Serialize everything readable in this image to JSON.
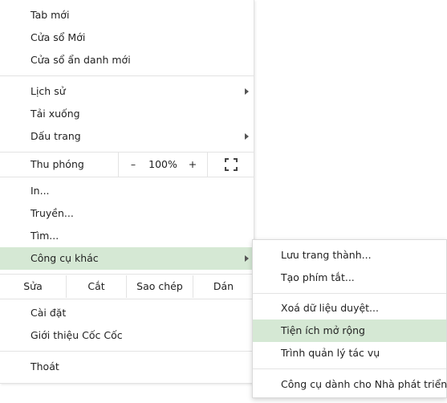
{
  "menu": {
    "new_tab": "Tab mới",
    "new_window": "Cửa sổ Mới",
    "new_incognito_window": "Cửa sổ ẩn danh mới",
    "history": "Lịch sử",
    "downloads": "Tải xuống",
    "bookmarks": "Dấu trang",
    "zoom": {
      "label": "Thu phóng",
      "minus": "–",
      "level": "100%",
      "plus": "+"
    },
    "print": "In...",
    "cast": "Truyền...",
    "find": "Tìm...",
    "more_tools": "Công cụ khác",
    "edit": {
      "label": "Sửa",
      "cut": "Cắt",
      "copy": "Sao chép",
      "paste": "Dán"
    },
    "settings": "Cài đặt",
    "about": "Giới thiệu Cốc Cốc",
    "exit": "Thoát"
  },
  "submenu": {
    "save_page": "Lưu trang thành...",
    "create_shortcut": "Tạo phím tắt...",
    "clear_browsing_data": "Xoá dữ liệu duyệt...",
    "extensions": "Tiện ích mở rộng",
    "task_manager": "Trình quản lý tác vụ",
    "developer_tools": "Công cụ dành cho Nhà phát triển"
  },
  "colors": {
    "highlight": "#d5e8d4",
    "separator": "#e3e3e3",
    "text": "#222222"
  }
}
